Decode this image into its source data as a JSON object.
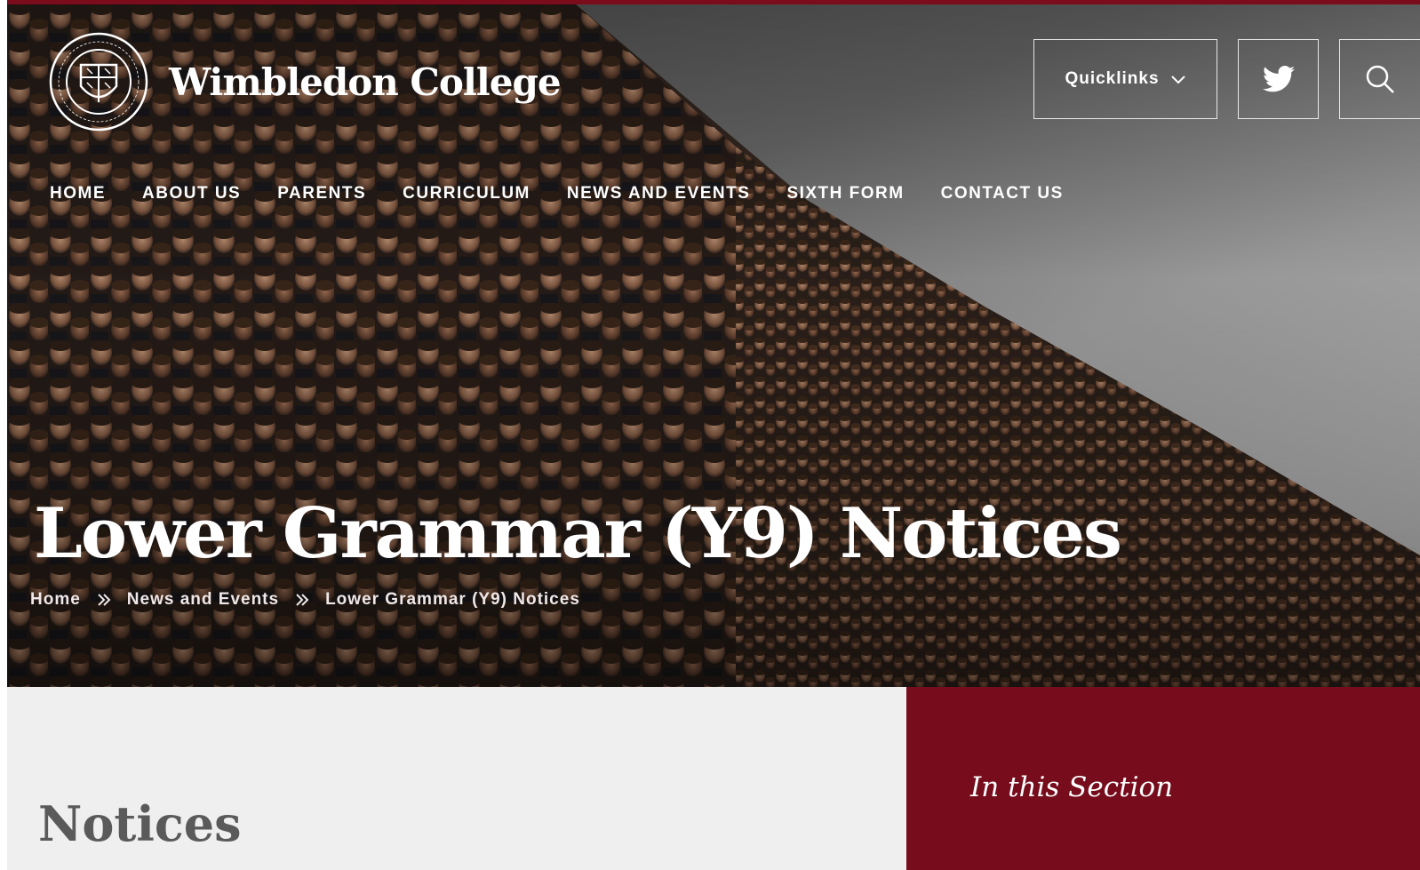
{
  "header": {
    "site_name": "Wimbledon College",
    "crest_icon": "college-crest-logo",
    "quicklinks_label": "Quicklinks",
    "twitter_icon": "twitter-bird-icon",
    "search_icon": "search-icon"
  },
  "nav": {
    "items": [
      {
        "label": "HOME"
      },
      {
        "label": "ABOUT US"
      },
      {
        "label": "PARENTS"
      },
      {
        "label": "CURRICULUM"
      },
      {
        "label": "NEWS AND EVENTS"
      },
      {
        "label": "SIXTH FORM"
      },
      {
        "label": "CONTACT US"
      }
    ]
  },
  "hero": {
    "title": "Lower Grammar (Y9) Notices",
    "breadcrumb": [
      "Home",
      "News and Events",
      "Lower Grammar (Y9) Notices"
    ]
  },
  "main": {
    "heading": "Notices"
  },
  "sidebar": {
    "title": "In this Section"
  },
  "colors": {
    "brand_maroon": "#760c1c",
    "panel_grey": "#efefef"
  }
}
